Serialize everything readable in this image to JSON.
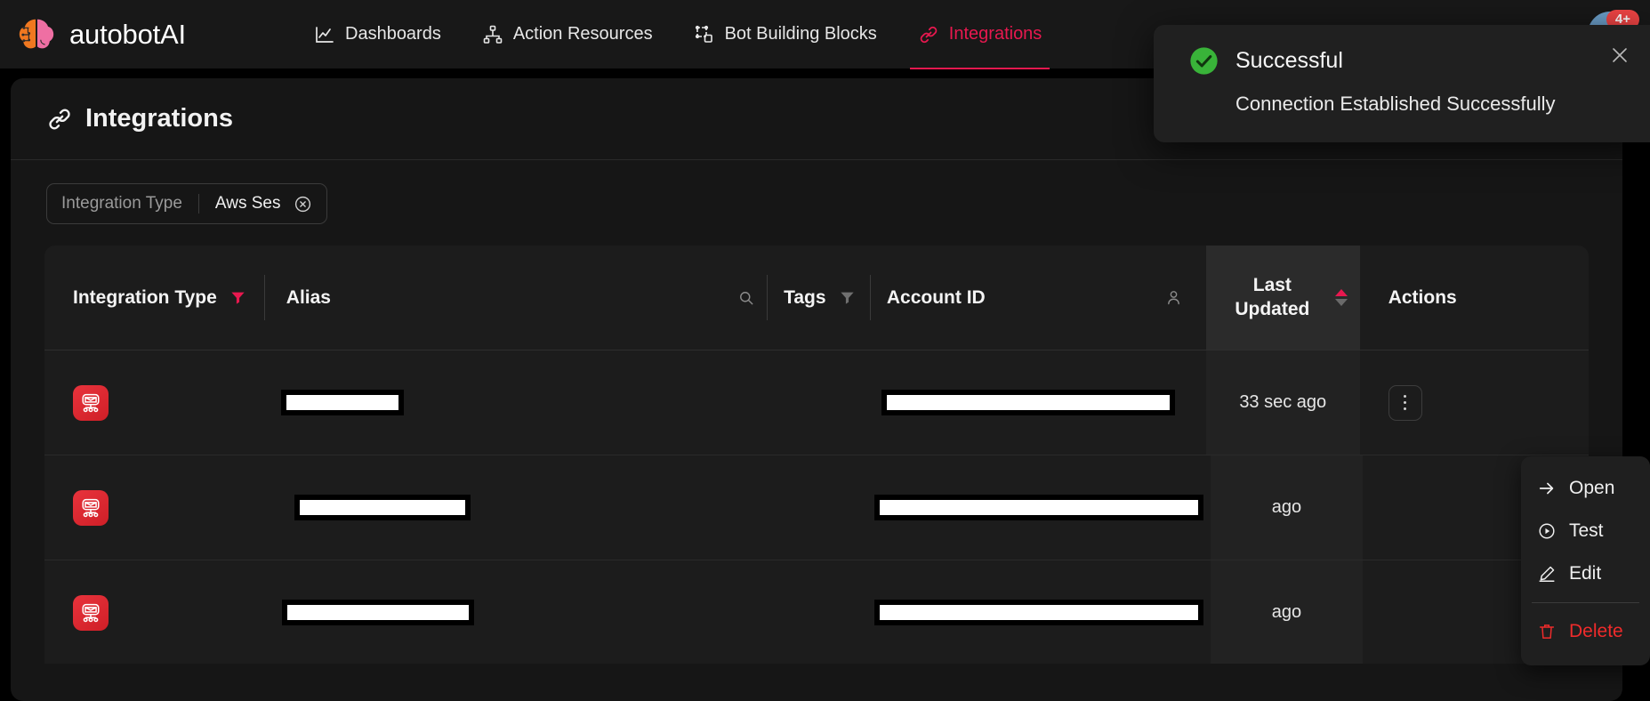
{
  "brand": {
    "name": "autobotAI",
    "logo_icon": "brain-circuit-logo"
  },
  "nav": {
    "items": [
      {
        "label": "Dashboards",
        "icon": "chart-line-icon",
        "active": false
      },
      {
        "label": "Action Resources",
        "icon": "sitemap-icon",
        "active": false
      },
      {
        "label": "Bot Building Blocks",
        "icon": "blocks-icon",
        "active": false
      },
      {
        "label": "Integrations",
        "icon": "link-chain-icon",
        "active": true
      }
    ],
    "notification_badge": "4+",
    "avatar_icon": "user-avatar"
  },
  "page": {
    "title": "Integrations",
    "title_icon": "link-chain-icon",
    "header_button_label": ""
  },
  "filters": [
    {
      "key": "Integration Type",
      "value": "Aws Ses",
      "clear_icon": "circle-x-icon"
    }
  ],
  "table": {
    "columns": [
      {
        "label": "Integration Type",
        "icon": "filter-funnel-icon-active"
      },
      {
        "label": "Alias",
        "icon": "search-icon"
      },
      {
        "label": "Tags",
        "icon": "filter-funnel-icon"
      },
      {
        "label": "Account ID",
        "icon": "person-icon"
      },
      {
        "label": "Last Updated",
        "icon": "sort-arrows-icon",
        "sorted": "asc"
      },
      {
        "label": "Actions",
        "icon": ""
      }
    ],
    "rows": [
      {
        "integration_icon": "aws-ses-icon",
        "alias": "",
        "alias_redacted": true,
        "alias_width": 126,
        "tags": "",
        "account_id": "",
        "account_redacted": true,
        "account_width": 318,
        "last_updated": "33 sec ago"
      },
      {
        "integration_icon": "aws-ses-icon",
        "alias": "",
        "alias_redacted": true,
        "alias_width": 186,
        "tags": "",
        "account_id": "",
        "account_redacted": true,
        "account_width": 540,
        "last_updated": "ago"
      },
      {
        "integration_icon": "aws-ses-icon",
        "alias": "",
        "alias_redacted": true,
        "alias_width": 204,
        "tags": "",
        "account_id": "",
        "account_redacted": true,
        "account_width": 540,
        "last_updated": "ago"
      }
    ]
  },
  "actions_menu": {
    "items": [
      {
        "label": "Open",
        "icon": "arrow-right-icon",
        "danger": false
      },
      {
        "label": "Test",
        "icon": "play-circle-icon",
        "danger": false
      },
      {
        "label": "Edit",
        "icon": "pencil-icon",
        "danger": false
      },
      {
        "label": "Delete",
        "icon": "trash-icon",
        "danger": true
      }
    ]
  },
  "toast": {
    "title": "Successful",
    "message": "Connection Established Successfully",
    "status_icon": "check-circle-icon",
    "close_icon": "close-x-icon"
  },
  "colors": {
    "accent": "#e8184f",
    "success": "#39b339",
    "danger": "#ef2b2b",
    "badge": "#ef4444",
    "page_bg": "#000000",
    "card_bg": "#161616",
    "table_bg": "#1c1c1c"
  }
}
